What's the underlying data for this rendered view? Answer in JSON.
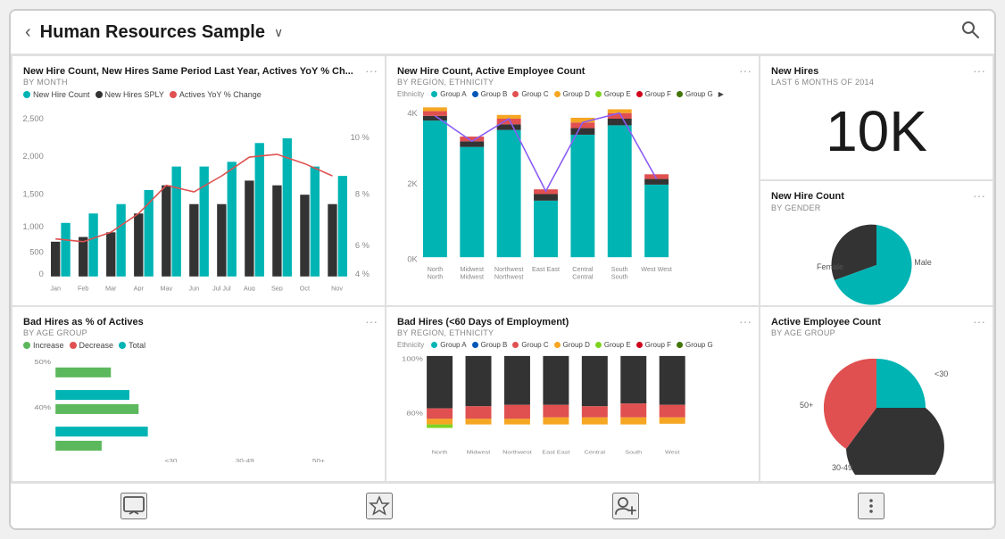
{
  "header": {
    "title": "Human Resources Sample",
    "back_label": "‹",
    "chevron": "∨",
    "search_icon": "🔍"
  },
  "cards": {
    "card1": {
      "title": "New Hire Count, New Hires Same Period Last Year, Actives YoY % Ch...",
      "subtitle": "BY MONTH",
      "legend": [
        {
          "label": "New Hire Count",
          "color": "#00B4B4"
        },
        {
          "label": "New Hires SPLY",
          "color": "#333"
        },
        {
          "label": "Actives YoY % Change",
          "color": "#e05050"
        }
      ]
    },
    "card2": {
      "title": "New Hire Count, Active Employee Count",
      "subtitle": "BY REGION, ETHNICITY",
      "legend_prefix": "Ethnicity",
      "legend": [
        {
          "label": "Group A",
          "color": "#00B4B4"
        },
        {
          "label": "Group B",
          "color": "#0057B8"
        },
        {
          "label": "Group C",
          "color": "#e05050"
        },
        {
          "label": "Group D",
          "color": "#f5a623"
        },
        {
          "label": "Group E",
          "color": "#7ed321"
        },
        {
          "label": "Group F",
          "color": "#d0021b"
        },
        {
          "label": "Group G",
          "color": "#417505"
        }
      ]
    },
    "card3": {
      "title": "New Hires",
      "subtitle": "LAST 6 MONTHS OF 2014",
      "kpi": "10K"
    },
    "card4": {
      "title": "Bad Hires as % of Actives",
      "subtitle": "BY AGE GROUP",
      "legend": [
        {
          "label": "Increase",
          "color": "#5cb85c"
        },
        {
          "label": "Decrease",
          "color": "#e05050"
        },
        {
          "label": "Total",
          "color": "#00B4B4"
        }
      ]
    },
    "card5": {
      "title": "Bad Hires (<60 Days of Employment)",
      "subtitle": "BY REGION, ETHNICITY",
      "legend_prefix": "Ethnicity",
      "legend": [
        {
          "label": "Group A",
          "color": "#00B4B4"
        },
        {
          "label": "Group B",
          "color": "#0057B8"
        },
        {
          "label": "Group C",
          "color": "#e05050"
        },
        {
          "label": "Group D",
          "color": "#f5a623"
        },
        {
          "label": "Group E",
          "color": "#7ed321"
        },
        {
          "label": "Group F",
          "color": "#d0021b"
        },
        {
          "label": "Group G",
          "color": "#417505"
        }
      ]
    },
    "card6": {
      "title": "Active Employee Count",
      "subtitle": "BY AGE GROUP",
      "pie_segments": [
        {
          "label": "<30",
          "color": "#00B4B4",
          "value": 25
        },
        {
          "label": "30-49",
          "color": "#333",
          "value": 45
        },
        {
          "label": "50+",
          "color": "#e05050",
          "value": 30
        }
      ]
    },
    "card_gender": {
      "title": "New Hire Count",
      "subtitle": "BY GENDER",
      "pie_segments": [
        {
          "label": "Female",
          "color": "#333",
          "value": 35
        },
        {
          "label": "Male",
          "color": "#00B4B4",
          "value": 65
        }
      ]
    }
  },
  "bottom_bar": {
    "icons": [
      {
        "name": "comment-icon",
        "symbol": "💬"
      },
      {
        "name": "star-icon",
        "symbol": "☆"
      },
      {
        "name": "add-person-icon",
        "symbol": "👤"
      },
      {
        "name": "more-icon",
        "symbol": "⋮"
      }
    ]
  }
}
